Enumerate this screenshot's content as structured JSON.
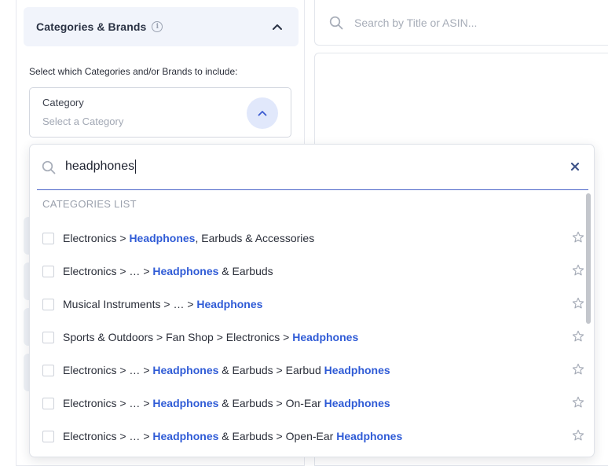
{
  "filters": {
    "section_title": "Categories & Brands",
    "instruction": "Select which Categories and/or Brands to include:",
    "category_label": "Category",
    "category_placeholder": "Select a Category"
  },
  "search": {
    "placeholder": "Search by Title or ASIN..."
  },
  "dropdown": {
    "query": "headphones",
    "list_header": "CATEGORIES LIST",
    "items": [
      {
        "parts": [
          {
            "t": "Electronics > "
          },
          {
            "t": "Headphones",
            "h": true
          },
          {
            "t": ", Earbuds & Accessories"
          }
        ]
      },
      {
        "parts": [
          {
            "t": "Electronics > … > "
          },
          {
            "t": "Headphones",
            "h": true
          },
          {
            "t": " & Earbuds"
          }
        ]
      },
      {
        "parts": [
          {
            "t": "Musical Instruments > … > "
          },
          {
            "t": "Headphones",
            "h": true
          }
        ]
      },
      {
        "parts": [
          {
            "t": "Sports & Outdoors > Fan Shop > Electronics > "
          },
          {
            "t": "Headphones",
            "h": true
          }
        ]
      },
      {
        "parts": [
          {
            "t": "Electronics > … > "
          },
          {
            "t": "Headphones",
            "h": true
          },
          {
            "t": " & Earbuds > Earbud "
          },
          {
            "t": "Headphones",
            "h": true
          }
        ]
      },
      {
        "parts": [
          {
            "t": "Electronics > … > "
          },
          {
            "t": "Headphones",
            "h": true
          },
          {
            "t": " & Earbuds > On-Ear "
          },
          {
            "t": "Headphones",
            "h": true
          }
        ]
      },
      {
        "parts": [
          {
            "t": "Electronics > … > "
          },
          {
            "t": "Headphones",
            "h": true
          },
          {
            "t": " & Earbuds > Open-Ear "
          },
          {
            "t": "Headphones",
            "h": true
          }
        ]
      }
    ]
  },
  "colors": {
    "accent": "#2f5bd6",
    "header_bg": "#f1f4fb",
    "toggle_bg": "#e1e8fb"
  }
}
